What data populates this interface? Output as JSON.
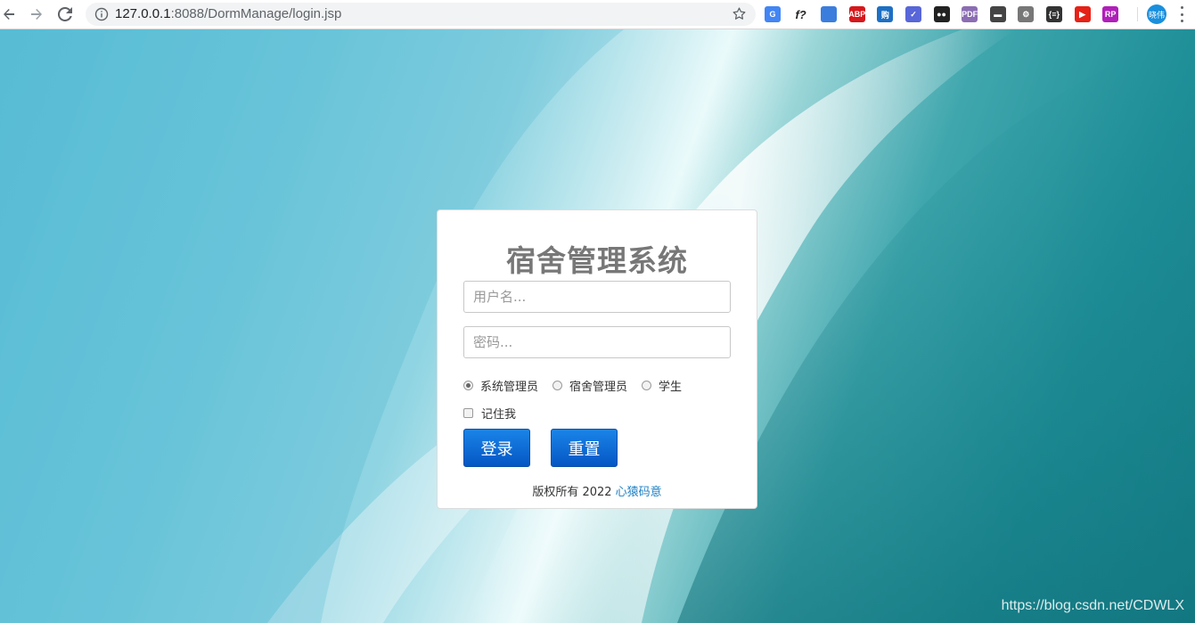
{
  "browser": {
    "url_host": "127.0.0.1",
    "url_rest": ":8088/DormManage/login.jsp",
    "profile_label": "晓伟",
    "extensions": [
      {
        "name": "google-translate-icon",
        "label": "G",
        "color": "#4285f4"
      },
      {
        "name": "formula-icon",
        "label": "f?",
        "color": "#ffffff"
      },
      {
        "name": "color-picker-icon",
        "label": "",
        "color": "#3b7ddd"
      },
      {
        "name": "adblock-icon",
        "label": "ABP",
        "color": "#d6171b"
      },
      {
        "name": "shopping-icon",
        "label": "购",
        "color": "#1d6fc4"
      },
      {
        "name": "checkmark-icon",
        "label": "✓",
        "color": "#5866d8"
      },
      {
        "name": "tampermonkey-icon",
        "label": "●●",
        "color": "#222222"
      },
      {
        "name": "pdf-icon",
        "label": "PDF",
        "color": "#8b6db3"
      },
      {
        "name": "spy-icon",
        "label": "▬",
        "color": "#444444"
      },
      {
        "name": "bike-icon",
        "label": "⚙",
        "color": "#777777"
      },
      {
        "name": "json-icon",
        "label": "{≡}",
        "color": "#333333"
      },
      {
        "name": "video-icon",
        "label": "▶",
        "color": "#e62117"
      },
      {
        "name": "rp-icon",
        "label": "RP",
        "color": "#b01fb9"
      }
    ]
  },
  "login": {
    "title": "宿舍管理系统",
    "username_placeholder": "用户名...",
    "password_placeholder": "密码...",
    "roles": [
      {
        "label": "系统管理员",
        "checked": true
      },
      {
        "label": "宿舍管理员",
        "checked": false
      },
      {
        "label": "学生",
        "checked": false
      }
    ],
    "remember_label": "记住我",
    "login_button": "登录",
    "reset_button": "重置",
    "copyright_prefix": "版权所有 2022",
    "copyright_link": "心猿码意"
  },
  "watermark": "https://blog.csdn.net/CDWLX"
}
